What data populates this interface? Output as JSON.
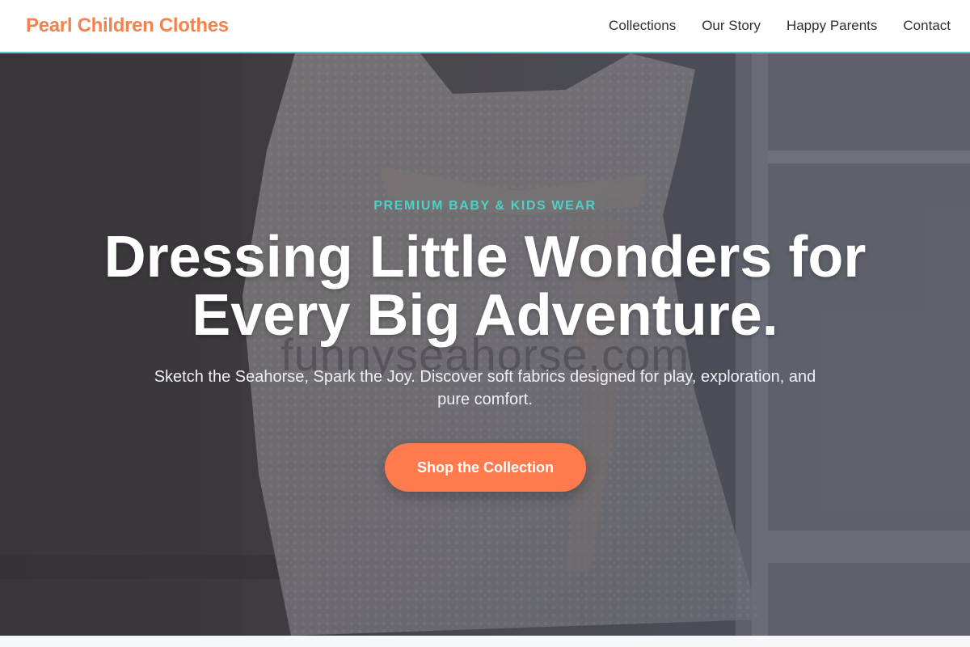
{
  "header": {
    "brand": "Pearl Children Clothes",
    "nav": [
      "Collections",
      "Our Story",
      "Happy Parents",
      "Contact"
    ]
  },
  "hero": {
    "eyebrow": "PREMIUM BABY & KIDS WEAR",
    "headline": "Dressing Little Wonders for Every Big Adventure.",
    "subtext": "Sketch the Seahorse, Spark the Joy. Discover soft fabrics designed for play, exploration, and pure comfort.",
    "cta": "Shop the Collection",
    "watermark": "funnyseahorse.com"
  },
  "colors": {
    "brand": "#f0834f",
    "accent": "#4fd1c5",
    "cta": "#ff7a4d"
  }
}
